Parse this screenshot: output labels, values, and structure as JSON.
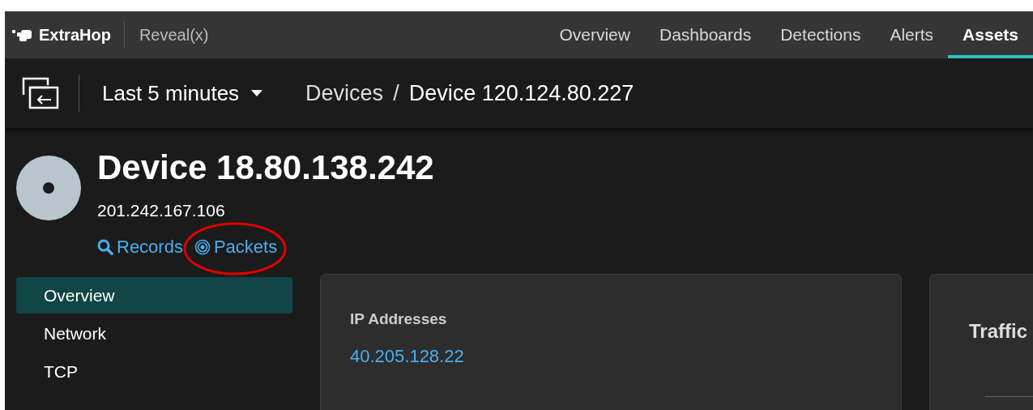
{
  "app": {
    "brand": "ExtraHop",
    "product": "Reveal(x)"
  },
  "nav_tabs": [
    {
      "label": "Overview",
      "selected": false
    },
    {
      "label": "Dashboards",
      "selected": false
    },
    {
      "label": "Detections",
      "selected": false
    },
    {
      "label": "Alerts",
      "selected": false
    },
    {
      "label": "Assets",
      "selected": true
    }
  ],
  "toolbar": {
    "time_range": "Last 5 minutes",
    "breadcrumb": [
      "Devices",
      "Device 120.124.80.227"
    ],
    "breadcrumb_separator": "/"
  },
  "device": {
    "title": "Device 18.80.138.242",
    "ip": "201.242.167.106",
    "links": [
      {
        "label": "Records",
        "kind": "records",
        "circled": false
      },
      {
        "label": "Packets",
        "kind": "packets",
        "circled": true
      }
    ]
  },
  "sidebar": {
    "items": [
      {
        "label": "Overview",
        "selected": true
      },
      {
        "label": "Network",
        "selected": false
      },
      {
        "label": "TCP",
        "selected": false
      }
    ]
  },
  "cards": [
    {
      "title": "IP Addresses",
      "value": "40.205.128.22"
    },
    {
      "title": "Traffic"
    }
  ]
}
